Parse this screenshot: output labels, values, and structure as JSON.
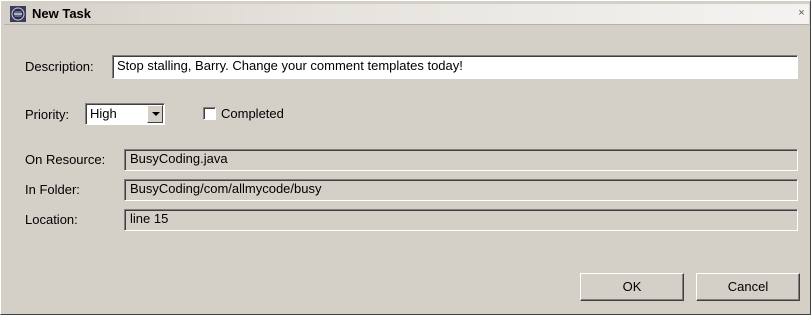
{
  "window": {
    "title": "New Task",
    "close_glyph": "×",
    "icon": "eclipse-app-icon"
  },
  "description": {
    "label": "Description:",
    "value": "Stop stalling, Barry. Change your comment templates today!"
  },
  "priority": {
    "label": "Priority:",
    "selected": "High"
  },
  "completed": {
    "label": "Completed",
    "checked": false
  },
  "resource": {
    "label": "On Resource:",
    "value": "BusyCoding.java"
  },
  "folder": {
    "label": "In Folder:",
    "value": "BusyCoding/com/allmycode/busy"
  },
  "location": {
    "label": "Location:",
    "value": "line 15"
  },
  "buttons": {
    "ok": "OK",
    "cancel": "Cancel"
  }
}
